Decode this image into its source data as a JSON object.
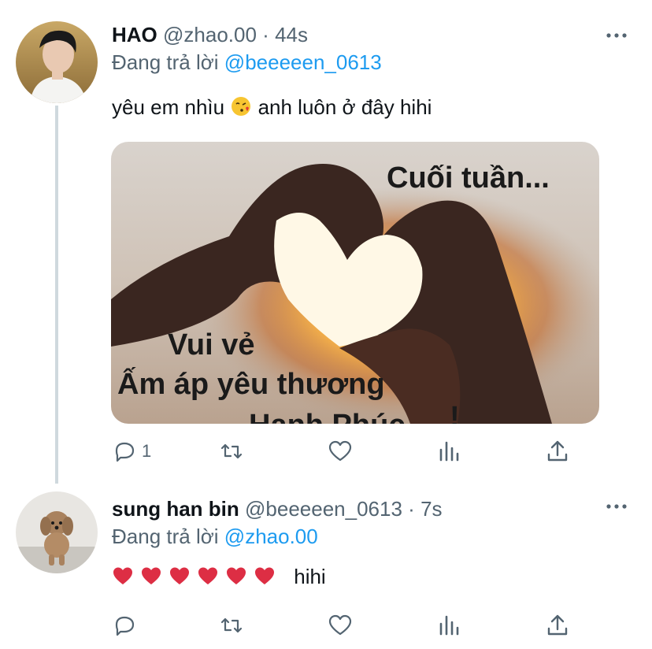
{
  "tweets": [
    {
      "name": "HAO",
      "handle": "@zhao.00",
      "separator": "·",
      "time": "44s",
      "reply_prefix": "Đang trả lời",
      "reply_to": "@beeeeen_0613",
      "text_before": "yêu em nhìu",
      "text_after": "anh luôn ở đây hihi",
      "image_caption": {
        "line1": "Cuối tuần...",
        "line2": "Vui vẻ",
        "line3": "Ấm áp yêu thương",
        "line4": "Hanh Phúc"
      },
      "reply_count": "1"
    },
    {
      "name": "sung han bin",
      "handle": "@beeeeen_0613",
      "separator": "·",
      "time": "7s",
      "reply_prefix": "Đang trả lời",
      "reply_to": "@zhao.00",
      "text": "hihi",
      "hearts": 6,
      "reply_count": ""
    }
  ],
  "icons": [
    "more-icon",
    "reply-icon",
    "retweet-icon",
    "like-icon",
    "analytics-icon",
    "share-icon",
    "kissing-emoji",
    "red-heart-emoji"
  ],
  "colors": {
    "link": "#1d9bf0",
    "muted": "#536471",
    "text": "#0f1419",
    "thread": "#cfd9de"
  }
}
